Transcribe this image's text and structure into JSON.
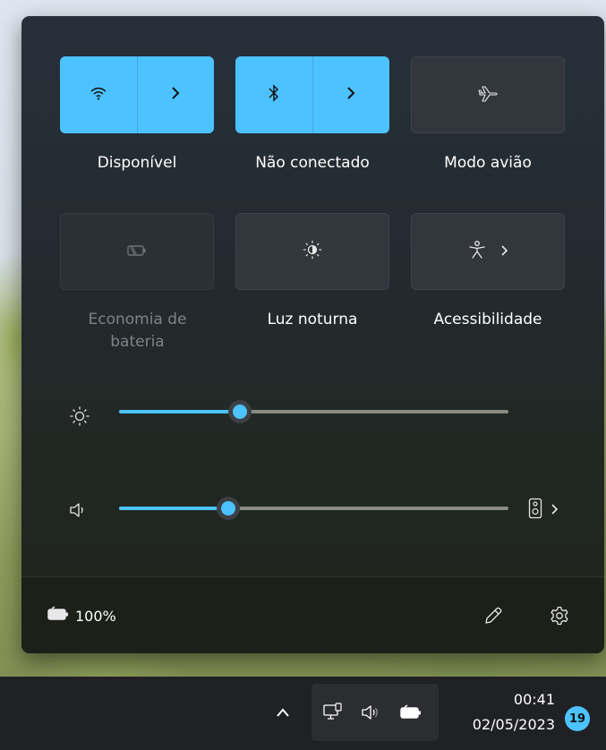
{
  "quick_settings": {
    "tiles": [
      {
        "label": "Disponível",
        "state": "on",
        "icon": "wifi-icon"
      },
      {
        "label": "Não conectado",
        "state": "on",
        "icon": "bluetooth-icon"
      },
      {
        "label": "Modo avião",
        "state": "off",
        "icon": "airplane-icon"
      },
      {
        "label": "Economia de bateria",
        "state": "disabled",
        "icon": "battery-saver-icon"
      },
      {
        "label": "Luz noturna",
        "state": "off",
        "icon": "night-light-icon"
      },
      {
        "label": "Acessibilidade",
        "state": "off",
        "icon": "accessibility-icon"
      }
    ],
    "brightness": {
      "icon": "brightness-icon",
      "value_fraction": 0.31
    },
    "volume": {
      "icon": "speaker-icon",
      "value_fraction": 0.28,
      "output_icon": "speaker-device-icon"
    }
  },
  "footer": {
    "battery_percent": "100%",
    "battery_icon": "battery-charging-icon",
    "edit_icon": "pencil-icon",
    "settings_icon": "gear-icon"
  },
  "taskbar": {
    "time": "00:41",
    "date": "02/05/2023",
    "notification_count": "19",
    "icons": [
      "chevron-up-icon",
      "network-icon",
      "volume-icon",
      "battery-icon"
    ]
  },
  "colors": {
    "accent": "#4cc2ff",
    "panel": "#262d33",
    "tile_off": "#31373d"
  }
}
